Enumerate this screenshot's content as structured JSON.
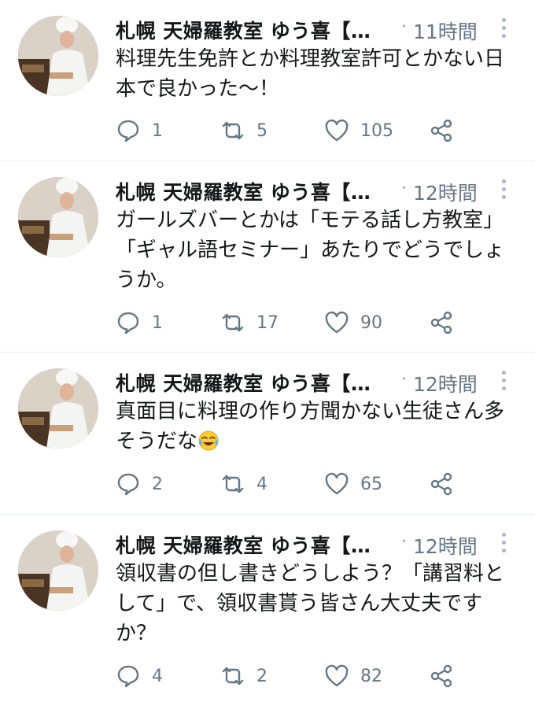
{
  "tweets": [
    {
      "name": "札幌 天婦羅教室 ゆう喜【…",
      "dot": "·",
      "time": "11時間",
      "text": "料理先生免許とか料理教室許可とかない日本で良かった〜！",
      "replies": "1",
      "retweets": "5",
      "likes": "105"
    },
    {
      "name": "札幌 天婦羅教室 ゆう喜【…",
      "dot": "·",
      "time": "12時間",
      "text": "ガールズバーとかは「モテる話し方教室」「ギャル語セミナー」あたりでどうでしょうか。",
      "replies": "1",
      "retweets": "17",
      "likes": "90"
    },
    {
      "name": "札幌 天婦羅教室 ゆう喜【…",
      "dot": "·",
      "time": "12時間",
      "text": "真面目に料理の作り方聞かない生徒さん多そうだな",
      "emoji": "face-with-tears-of-joy",
      "replies": "2",
      "retweets": "4",
      "likes": "65"
    },
    {
      "name": "札幌 天婦羅教室 ゆう喜【…",
      "dot": "·",
      "time": "12時間",
      "text": "領収書の但し書きどうしよう？「講習料として」で、領収書貰う皆さん大丈夫ですか？",
      "replies": "4",
      "retweets": "2",
      "likes": "82"
    }
  ],
  "icons": {
    "reply": "reply-icon",
    "retweet": "retweet-icon",
    "like": "like-icon",
    "share": "share-icon",
    "more": "more-options-icon"
  },
  "colors": {
    "icon_gray": "#657786",
    "text": "#14171a",
    "divider": "#e6ecf0"
  }
}
